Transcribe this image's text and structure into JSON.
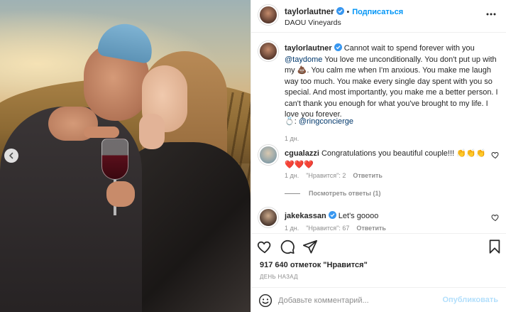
{
  "header": {
    "username": "taylorlautner",
    "follow_label": "Подписаться",
    "location": "DAOU Vineyards",
    "separator": "•"
  },
  "caption": {
    "username": "taylorlautner",
    "text_1": "Cannot wait to spend forever with you ",
    "mention": "@taydome",
    "text_2": " You love me unconditionally. You don't put up with my 💩. You calm me when I'm anxious. You make me laugh way too much. You make every single day spent with you so special. And most importantly, you make me a better person. I can't thank you enough for what you've brought to my life. I love you forever.",
    "emoji": "💍",
    "mention_2": "@ringconcierge",
    "time": "1 дн."
  },
  "comments": [
    {
      "username": "cgualazzi",
      "text": "Congratulations you beautiful couple!!! 👏👏👏❤️❤️❤️",
      "time": "1 дн.",
      "likes": "\"Нравится\": 2",
      "reply": "Ответить",
      "view_replies": "Посмотреть ответы (1)"
    },
    {
      "username": "jakekassan",
      "text": "Let's goooo",
      "time": "1 дн.",
      "likes": "\"Нравится\": 67",
      "reply": "Ответить"
    }
  ],
  "post": {
    "likes": "917 640 отметок \"Нравится\"",
    "time_ago": "ДЕНЬ НАЗАД",
    "add_comment_placeholder": "Добавьте комментарий...",
    "publish_label": "Опубликовать"
  },
  "icons": {
    "verified": "verified-badge-icon",
    "more": "more-options-icon",
    "like": "heart-icon",
    "comment": "comment-icon",
    "share": "share-icon",
    "save": "bookmark-icon",
    "emoji": "smiley-icon",
    "carousel_prev": "chevron-left-icon"
  },
  "colors": {
    "accent": "#0095f6",
    "verified": "#3897f0",
    "mention": "#00376b",
    "muted": "#8e8e8e",
    "publish_disabled": "#b2dffc"
  }
}
